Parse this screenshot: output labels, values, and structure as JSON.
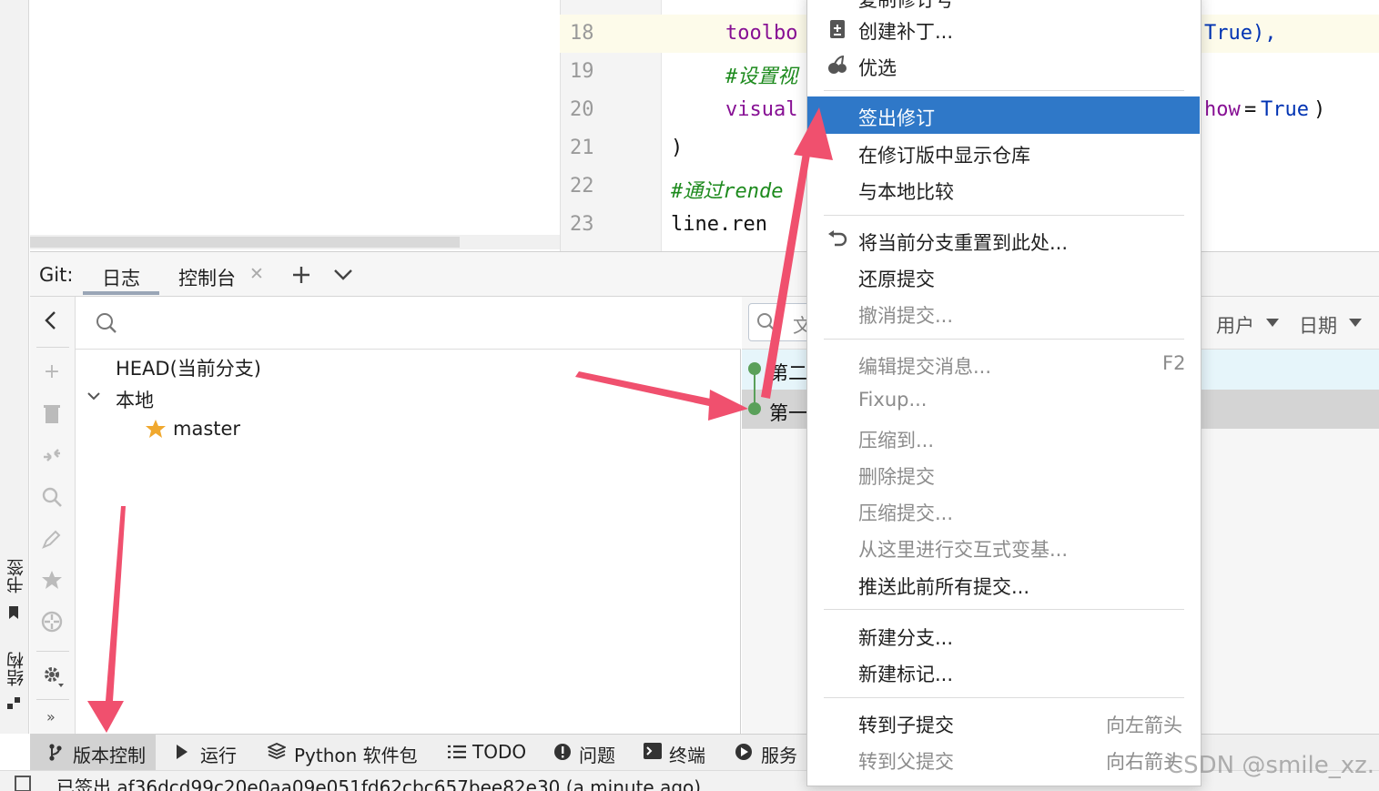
{
  "editor": {
    "line_numbers": [
      "18",
      "19",
      "20",
      "21",
      "22",
      "23"
    ],
    "lines": [
      {
        "text": "toolbo",
        "color": "#871094"
      },
      {
        "text": "#设置视",
        "color": "#1d8a1d"
      },
      {
        "text": "visual",
        "color": "#871094"
      },
      {
        "text": ")",
        "color": "#111111"
      },
      {
        "text": "#通过rende",
        "color": "#1d8a1d"
      },
      {
        "text": "line.ren",
        "color": "#111111"
      }
    ],
    "right_fragments": {
      "line18": "True),",
      "line20_kw": "how",
      "line20_eq": "=",
      "line20_val": "True",
      "line20_close": ")"
    }
  },
  "git": {
    "label": "Git:",
    "tabs": [
      {
        "label": "日志",
        "active": true
      },
      {
        "label": "控制台",
        "closable": true
      }
    ],
    "add_icon": "plus-icon",
    "menu_icon": "chevron-down-icon"
  },
  "branches": {
    "head": "HEAD(当前分支)",
    "local_group": "本地",
    "items": [
      {
        "name": "master",
        "starred": true
      }
    ]
  },
  "log": {
    "filter_placeholder": "文",
    "filters": [
      {
        "label": "用户"
      },
      {
        "label": "日期"
      }
    ],
    "commits": [
      {
        "message": "第二"
      },
      {
        "message": "第一"
      }
    ]
  },
  "context_menu": {
    "partial_top": "复制修订号",
    "items": [
      {
        "label": "创建补丁...",
        "icon": "patch-icon",
        "enabled": true
      },
      {
        "label": "优选",
        "icon": "cherry-pick-icon",
        "enabled": true
      },
      {
        "label": "签出修订",
        "enabled": true,
        "selected": true
      },
      {
        "label": "在修订版中显示仓库",
        "enabled": true
      },
      {
        "label": "与本地比较",
        "enabled": true
      },
      {
        "label": "将当前分支重置到此处...",
        "icon": "undo-icon",
        "enabled": true
      },
      {
        "label": "还原提交",
        "enabled": true
      },
      {
        "label": "撤消提交...",
        "enabled": false
      },
      {
        "label": "编辑提交消息...",
        "shortcut": "F2",
        "enabled": false
      },
      {
        "label": "Fixup...",
        "enabled": false
      },
      {
        "label": "压缩到...",
        "enabled": false
      },
      {
        "label": "删除提交",
        "enabled": false
      },
      {
        "label": "压缩提交...",
        "enabled": false
      },
      {
        "label": "从这里进行交互式变基...",
        "enabled": false
      },
      {
        "label": "推送此前所有提交...",
        "enabled": true
      },
      {
        "label": "新建分支...",
        "enabled": true
      },
      {
        "label": "新建标记...",
        "enabled": true
      },
      {
        "label": "转到子提交",
        "shortcut": "向左箭头",
        "enabled": true
      },
      {
        "label": "转到父提交",
        "shortcut": "向右箭头",
        "enabled": false
      }
    ]
  },
  "bottom_bar": {
    "items": [
      {
        "label": "版本控制",
        "icon": "branch-icon",
        "active": true
      },
      {
        "label": "运行",
        "icon": "play-icon"
      },
      {
        "label": "Python 软件包",
        "icon": "layers-icon"
      },
      {
        "label": "TODO",
        "icon": "list-icon"
      },
      {
        "label": "问题",
        "icon": "info-icon"
      },
      {
        "label": "终端",
        "icon": "terminal-icon"
      },
      {
        "label": "服务",
        "icon": "services-icon"
      }
    ]
  },
  "left_stripe": {
    "bookmarks_label": "书签",
    "structure_label": "结构"
  },
  "status_bar": {
    "message": "已签出 af36dcd99c20e0aa09e051fd62cbc657bee82e30 (a minute ago)"
  },
  "watermark": "CSDN @smile_xz.",
  "colors": {
    "selection": "#2f78c8",
    "arrow": "#f0506e",
    "commit_dot": "#5aa05a"
  }
}
